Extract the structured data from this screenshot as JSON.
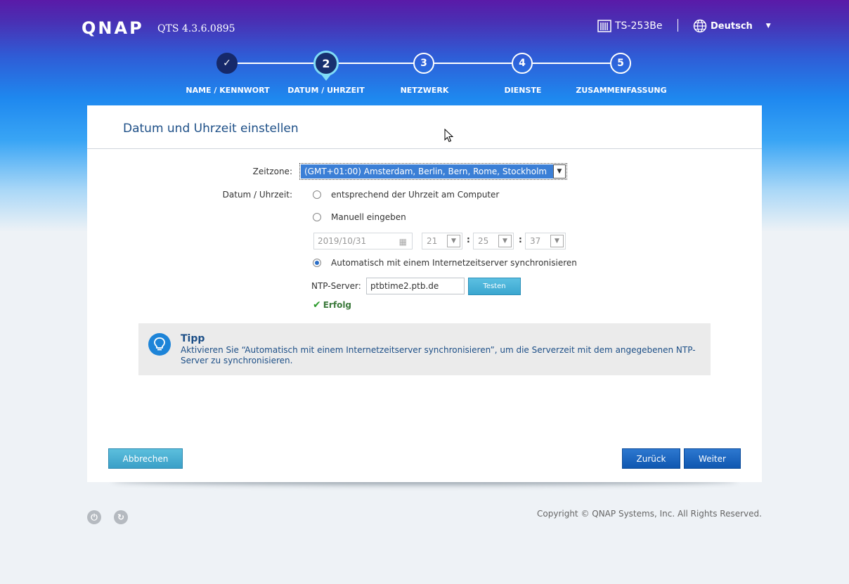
{
  "header": {
    "logo": "QNAP",
    "version": "QTS 4.3.6.0895",
    "device_name": "TS-253Be",
    "language": "Deutsch"
  },
  "stepper": {
    "steps": [
      {
        "number": "✓",
        "label": "NAME / KENNWORT",
        "state": "done"
      },
      {
        "number": "2",
        "label": "DATUM / UHRZEIT",
        "state": "active"
      },
      {
        "number": "3",
        "label": "NETZWERK",
        "state": "pending"
      },
      {
        "number": "4",
        "label": "DIENSTE",
        "state": "pending"
      },
      {
        "number": "5",
        "label": "ZUSAMMENFASSUNG",
        "state": "pending"
      }
    ]
  },
  "panel": {
    "title": "Datum und Uhrzeit einstellen",
    "timezone_label": "Zeitzone:",
    "timezone_value": "(GMT+01:00) Amsterdam, Berlin, Bern, Rome, Stockholm",
    "datetime_label": "Datum / Uhrzeit:",
    "options": {
      "computer": "entsprechend der Uhrzeit am Computer",
      "manual": "Manuell eingeben",
      "ntp": "Automatisch mit einem Internetzeitserver synchronisieren"
    },
    "selected_option": "ntp",
    "manual": {
      "date": "2019/10/31",
      "hour": "21",
      "minute": "25",
      "second": "37",
      "separator": ":"
    },
    "ntp_label": "NTP-Server:",
    "ntp_value": "ptbtime2.ptb.de",
    "test_button": "Testen",
    "status": "Erfolg"
  },
  "tip": {
    "title": "Tipp",
    "text": "Aktivieren Sie “Automatisch mit einem Internetzeitserver synchronisieren”, um die Serverzeit mit dem angegebenen NTP-Server zu synchronisieren."
  },
  "buttons": {
    "cancel": "Abbrechen",
    "back": "Zurück",
    "next": "Weiter"
  },
  "footer": {
    "copyright": "Copyright © QNAP Systems, Inc. All Rights Reserved."
  },
  "colors": {
    "primary_button": "#0f57b0",
    "secondary_button": "#3a9fc7",
    "title_text": "#1d4f87"
  }
}
